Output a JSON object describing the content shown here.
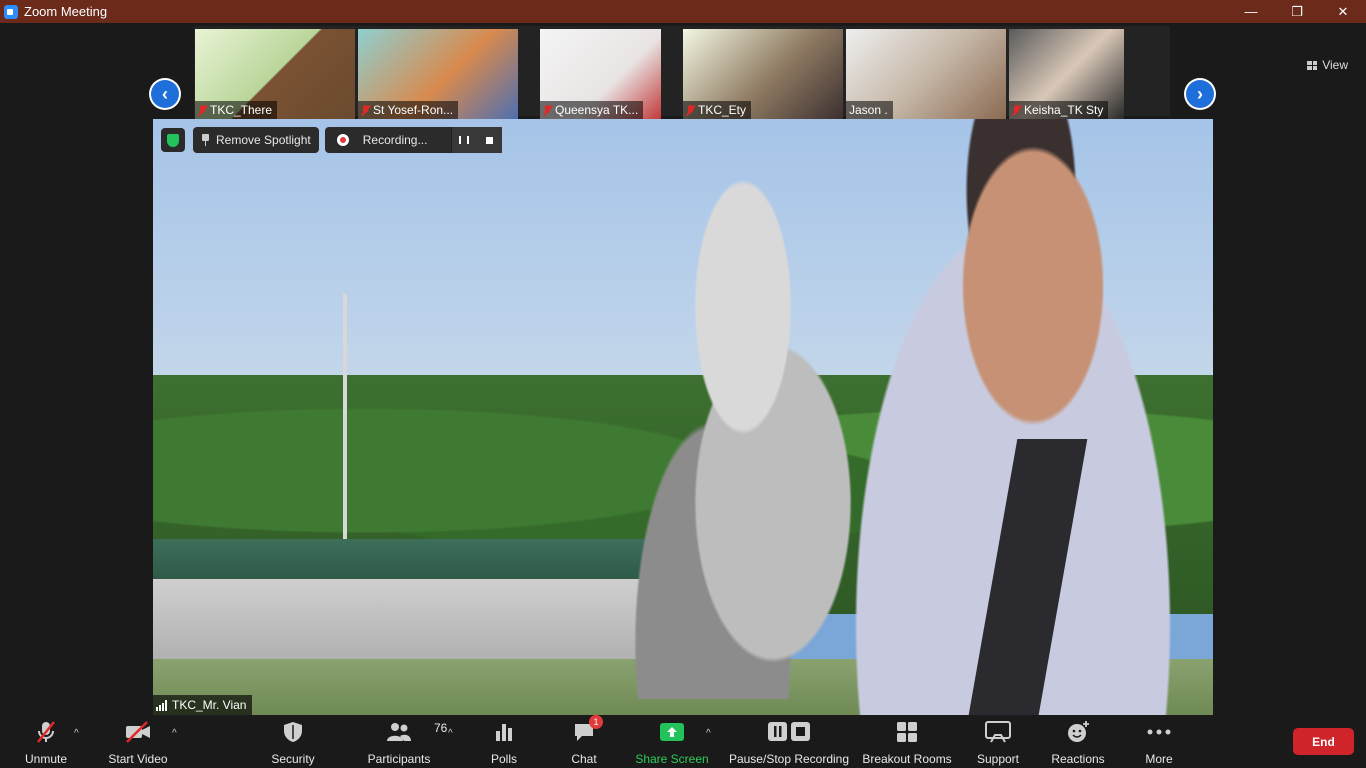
{
  "window": {
    "title": "Zoom Meeting",
    "minimize": "—",
    "restore": "❐",
    "close": "✕"
  },
  "gallery": {
    "view_label": "View",
    "thumbnails": [
      {
        "name": "TKC_There"
      },
      {
        "name": "St Yosef-Ron..."
      },
      {
        "name": "Queensya TK..."
      },
      {
        "name": "TKC_Ety"
      },
      {
        "name": "Jason ."
      },
      {
        "name": "Keisha_TK Sty"
      }
    ]
  },
  "main_video": {
    "remove_spotlight_label": "Remove Spotlight",
    "recording_label": "Recording...",
    "speaker_name": "TKC_Mr. Vian"
  },
  "toolbar": {
    "unmute": "Unmute",
    "start_video": "Start Video",
    "security": "Security",
    "participants": "Participants",
    "participants_count": "76",
    "polls": "Polls",
    "chat": "Chat",
    "chat_badge": "1",
    "share_screen": "Share Screen",
    "pause_stop_recording": "Pause/Stop Recording",
    "breakout_rooms": "Breakout Rooms",
    "support": "Support",
    "reactions": "Reactions",
    "more": "More",
    "end": "End"
  },
  "colors": {
    "titlebar": "#6b2a1a",
    "accent_blue": "#1e6fd9",
    "share_green": "#23c25b",
    "end_red": "#d0242b",
    "mute_red": "#e02828"
  }
}
